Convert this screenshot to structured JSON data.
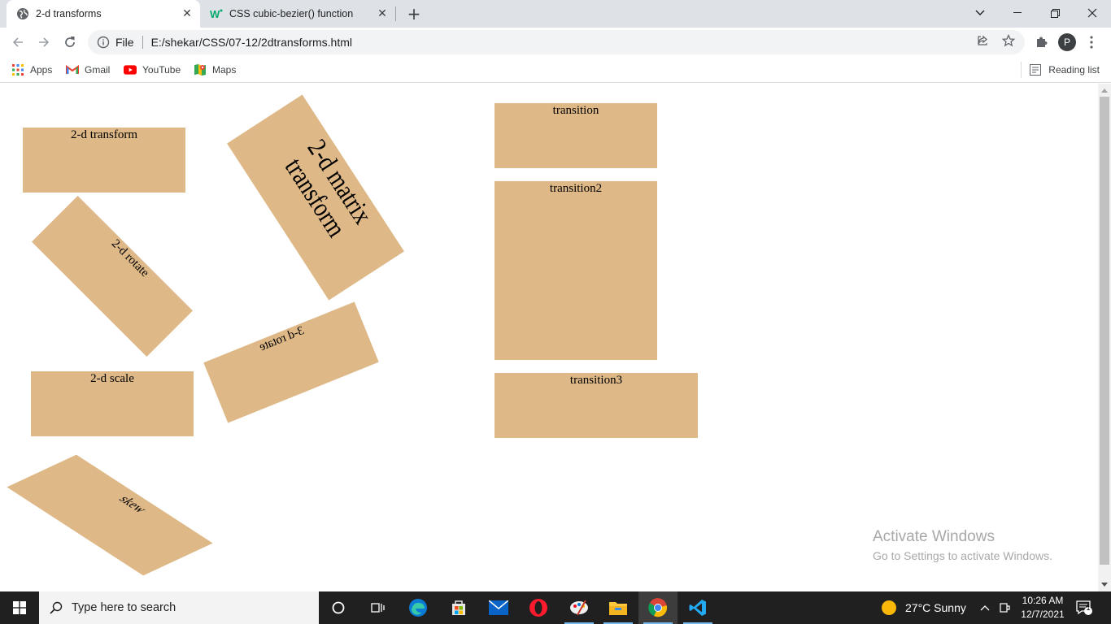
{
  "browser": {
    "tabs": [
      {
        "title": "2-d transforms",
        "active": true,
        "icon": "globe-icon"
      },
      {
        "title": "CSS cubic-bezier() function",
        "active": false,
        "icon": "w3schools-icon"
      }
    ],
    "address": {
      "scheme_label": "File",
      "url": "E:/shekar/CSS/07-12/2dtransforms.html"
    },
    "profile_initial": "P",
    "bookmarks": [
      {
        "label": "Apps",
        "icon": "apps-grid-icon"
      },
      {
        "label": "Gmail",
        "icon": "gmail-icon"
      },
      {
        "label": "YouTube",
        "icon": "youtube-icon"
      },
      {
        "label": "Maps",
        "icon": "maps-icon"
      }
    ],
    "reading_list_label": "Reading list"
  },
  "page": {
    "box_color": "#deb887",
    "boxes": {
      "transform": "2-d transform",
      "rotate": "2-d rotate",
      "scale": "2-d scale",
      "skew": "skew",
      "matrix": "2-d matrix transform",
      "rotate3d": "3-d rotate",
      "transition": "transition",
      "transition2": "transition2",
      "transition3": "transition3"
    }
  },
  "watermark": {
    "line1": "Activate Windows",
    "line2": "Go to Settings to activate Windows."
  },
  "taskbar": {
    "search_placeholder": "Type here to search",
    "weather": "27°C  Sunny",
    "time": "10:26 AM",
    "date": "12/7/2021",
    "notification_count": "1"
  }
}
